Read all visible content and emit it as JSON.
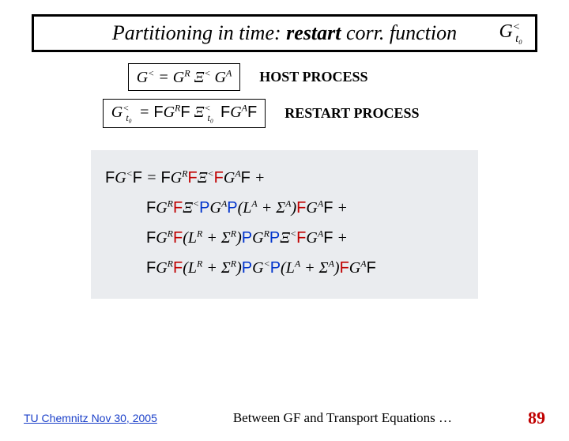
{
  "title": {
    "prefix": "Partitioning in time: ",
    "bold": "restart",
    "suffix": " corr. function",
    "corner_base": "G",
    "corner_sup": "<",
    "corner_sub": "t₀"
  },
  "host": {
    "equation": "G<  =  GR Ξ< GA",
    "label": "HOST PROCESS"
  },
  "restart": {
    "equation_prefix": "G",
    "equation_sup1": "<",
    "equation_sub": "t₀",
    "equation_body": " = F GR F Ξ",
    "equation_sup2": "<",
    "equation_sub2": "t₀",
    "equation_tail": " F GA F",
    "label": "RESTART PROCESS"
  },
  "main_eq": {
    "line1_a": "F",
    "line1_b": "G< ",
    "line1_c": "= ",
    "line1_d": "F",
    "line1_e": "GR",
    "line1_f": "F",
    "line1_g": "Ξ<",
    "line1_h": "F",
    "line1_i": "GA",
    "line1_j": "F",
    "line1_plus": " +",
    "line2_a": "F",
    "line2_b": "GR",
    "line2_c": "F",
    "line2_d": "Ξ<",
    "line2_e": "P",
    "line2_f": "GA",
    "line2_g": "P",
    "line2_h": "(LA + ΣA)",
    "line2_i": "F",
    "line2_j": "GA",
    "line2_k": "F",
    "line2_plus": " +",
    "line3_a": "F",
    "line3_b": "GR",
    "line3_c": "F",
    "line3_d": "(LR + ΣR)",
    "line3_e": "P",
    "line3_f": "GR",
    "line3_g": "P",
    "line3_h": "Ξ<",
    "line3_i": "F",
    "line3_j": "GA",
    "line3_k": "F",
    "line3_plus": " +",
    "line4_a": "F",
    "line4_b": "GR",
    "line4_c": "F",
    "line4_d": "(LR + ΣR)",
    "line4_e": "P",
    "line4_f": "G<",
    "line4_g": "P",
    "line4_h": "(LA + ΣA)",
    "line4_i": "F",
    "line4_j": "GA",
    "line4_k": "F"
  },
  "footer": {
    "left": "TU Chemnitz Nov 30, 2005",
    "center": "Between GF and Transport Equations …",
    "page": "89"
  }
}
